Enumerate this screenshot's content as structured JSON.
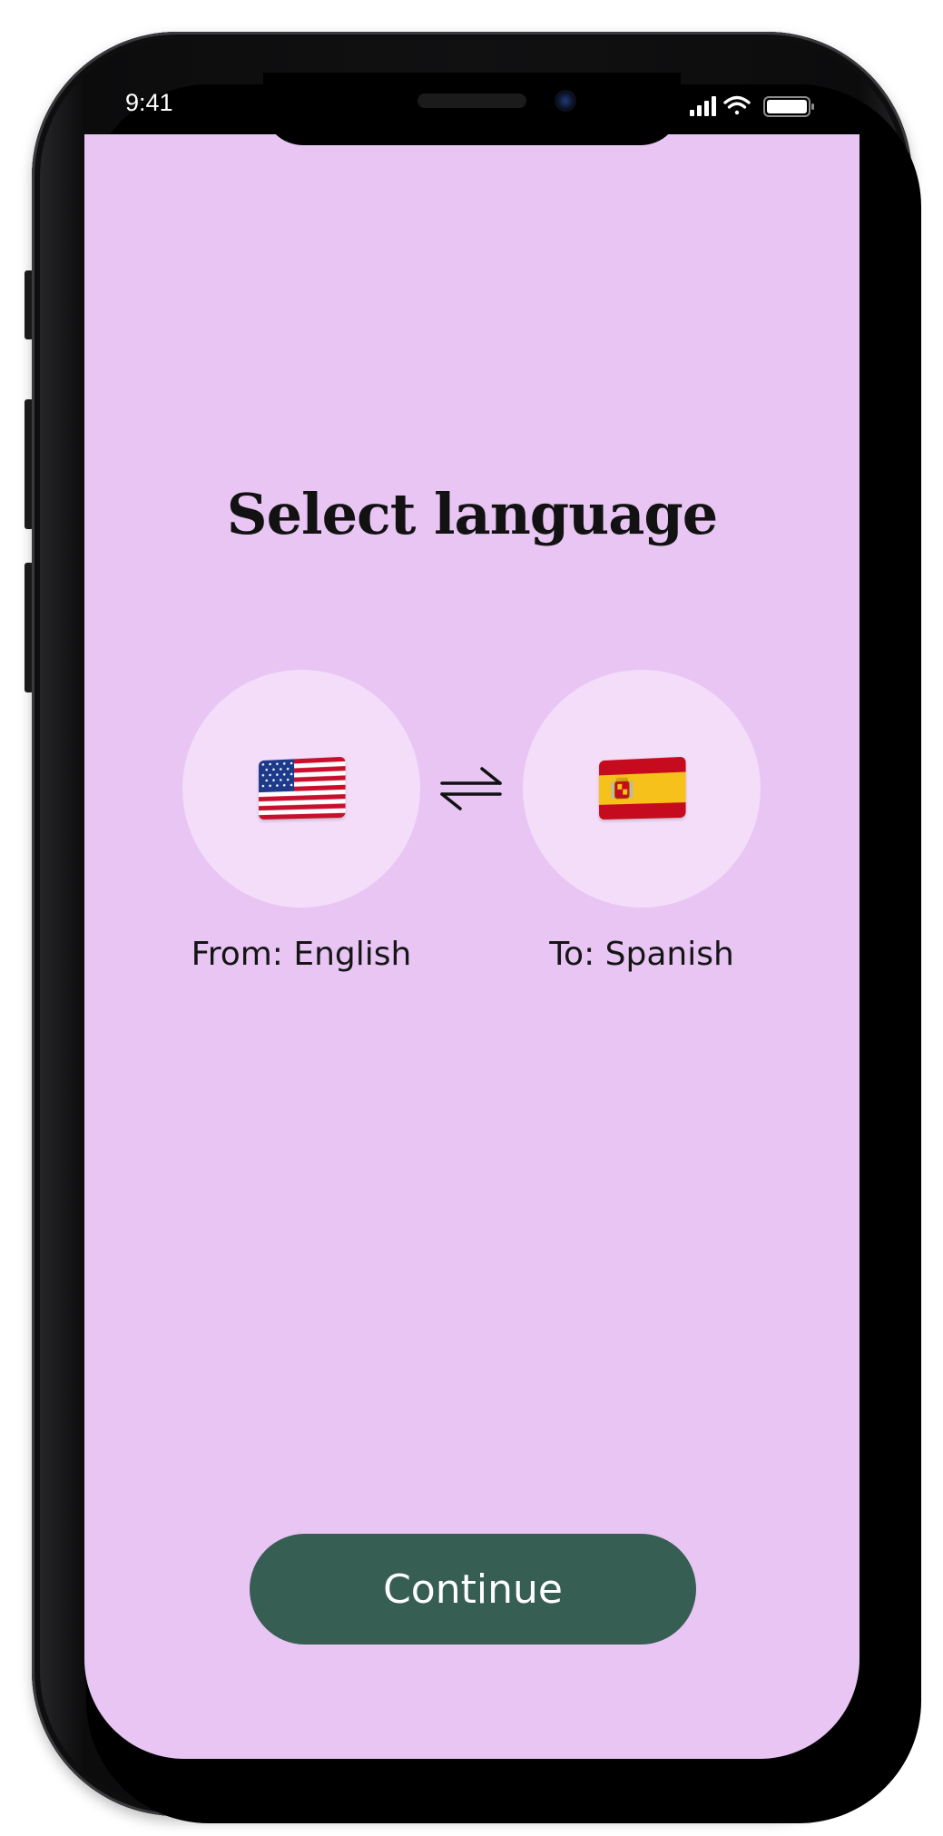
{
  "status_bar": {
    "time": "9:41",
    "icons": [
      "cellular-signal-icon",
      "wifi-icon",
      "battery-icon"
    ]
  },
  "screen": {
    "title": "Select language",
    "from": {
      "label": "From: English",
      "flag_icon": "us-flag-icon"
    },
    "to": {
      "label": "To: Spanish",
      "flag_icon": "spain-flag-icon"
    },
    "swap_icon": "swap-arrows-icon",
    "continue_label": "Continue"
  },
  "colors": {
    "background": "#e8c5f3",
    "circle": "#f3ddf9",
    "button": "#365e52",
    "button_text": "#ffffff",
    "text": "#151515"
  }
}
